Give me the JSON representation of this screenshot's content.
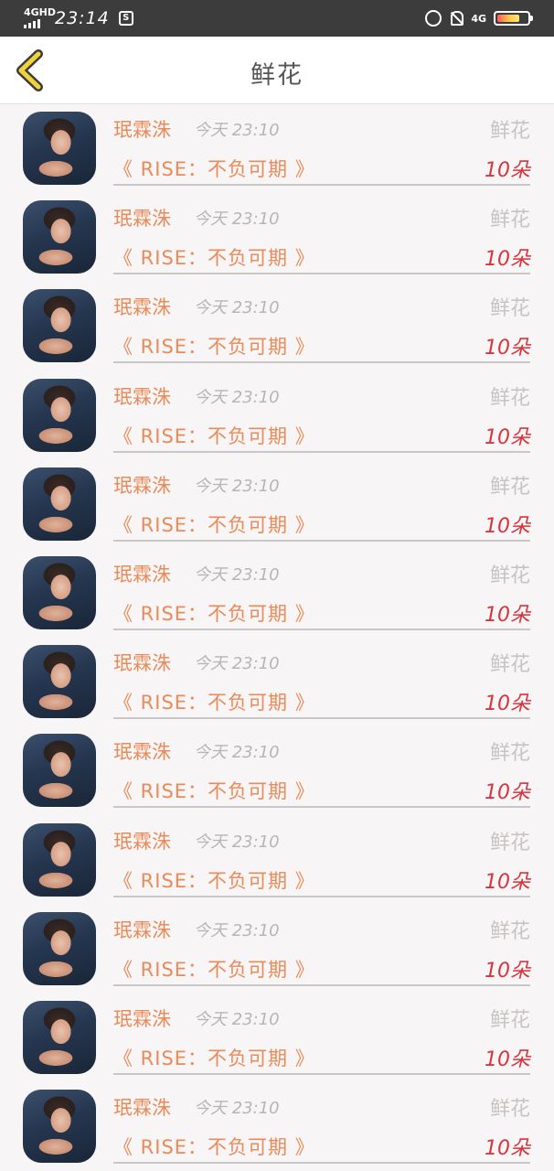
{
  "status_bar": {
    "network_left": "4GHD",
    "time": "23:14",
    "app_icon_glyph": "S",
    "network_right": "4G",
    "icons": [
      "signal-icon",
      "app-notification-icon",
      "alarm-icon",
      "mute-bell-icon",
      "battery-icon"
    ]
  },
  "nav": {
    "back_icon": "chevron-left-icon",
    "title": "鲜花"
  },
  "colors": {
    "accent_orange": "#ea8a59",
    "count_red": "#d8343d",
    "back_yellow": "#f0d23a",
    "muted_gray": "#c8c4c4"
  },
  "records": [
    {
      "user": "珉霖洙",
      "time": "今天 23:10",
      "gift": "鲜花",
      "title": "《 RISE：不负可期 》",
      "count": "10朵"
    },
    {
      "user": "珉霖洙",
      "time": "今天 23:10",
      "gift": "鲜花",
      "title": "《 RISE：不负可期 》",
      "count": "10朵"
    },
    {
      "user": "珉霖洙",
      "time": "今天 23:10",
      "gift": "鲜花",
      "title": "《 RISE：不负可期 》",
      "count": "10朵"
    },
    {
      "user": "珉霖洙",
      "time": "今天 23:10",
      "gift": "鲜花",
      "title": "《 RISE：不负可期 》",
      "count": "10朵"
    },
    {
      "user": "珉霖洙",
      "time": "今天 23:10",
      "gift": "鲜花",
      "title": "《 RISE：不负可期 》",
      "count": "10朵"
    },
    {
      "user": "珉霖洙",
      "time": "今天 23:10",
      "gift": "鲜花",
      "title": "《 RISE：不负可期 》",
      "count": "10朵"
    },
    {
      "user": "珉霖洙",
      "time": "今天 23:10",
      "gift": "鲜花",
      "title": "《 RISE：不负可期 》",
      "count": "10朵"
    },
    {
      "user": "珉霖洙",
      "time": "今天 23:10",
      "gift": "鲜花",
      "title": "《 RISE：不负可期 》",
      "count": "10朵"
    },
    {
      "user": "珉霖洙",
      "time": "今天 23:10",
      "gift": "鲜花",
      "title": "《 RISE：不负可期 》",
      "count": "10朵"
    },
    {
      "user": "珉霖洙",
      "time": "今天 23:10",
      "gift": "鲜花",
      "title": "《 RISE：不负可期 》",
      "count": "10朵"
    },
    {
      "user": "珉霖洙",
      "time": "今天 23:10",
      "gift": "鲜花",
      "title": "《 RISE：不负可期 》",
      "count": "10朵"
    },
    {
      "user": "珉霖洙",
      "time": "今天 23:10",
      "gift": "鲜花",
      "title": "《 RISE：不负可期 》",
      "count": "10朵"
    }
  ]
}
